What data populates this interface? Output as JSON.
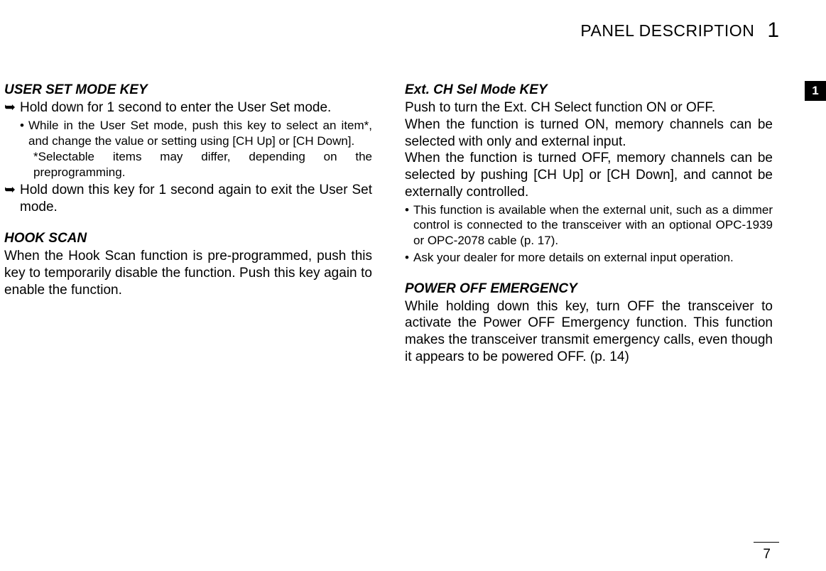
{
  "header": {
    "title": "PANEL DESCRIPTION",
    "chapter": "1"
  },
  "side_tab": "1",
  "left": {
    "user_set": {
      "title": "USER SET MODE KEY",
      "arrow1": "Hold down for 1 second to enter the User Set mode.",
      "bullet1": "While in the User Set mode, push this key to select an item*, and change the value or setting using [CH Up] or [CH Down].",
      "star": "*Selectable items may differ, depending on the preprogramming.",
      "arrow2": "Hold down this key for 1 second again to exit the User Set mode."
    },
    "hook_scan": {
      "title": "HOOK SCAN",
      "body": "When the Hook Scan function is pre-programmed, push this key to temporarily disable the function. Push this key again to enable the function."
    }
  },
  "right": {
    "ext_ch": {
      "title": "Ext. CH Sel Mode KEY",
      "p1": "Push to turn the Ext. CH Select function ON or OFF.",
      "p2": "When the function is turned ON, memory channels can be selected with only and external input.",
      "p3": "When the function is turned OFF, memory channels can be selected by pushing [CH Up] or [CH Down], and cannot be externally controlled.",
      "bullet1": "This function is available when the external unit, such as a dimmer control is connected to the transceiver with an optional OPC-1939 or OPC-2078 cable (p. 17).",
      "bullet2": "Ask your dealer for more details on external input operation."
    },
    "power_off": {
      "title": "POWER OFF EMERGENCY",
      "body": "While holding down this key, turn OFF the transceiver to activate the Power OFF Emergency function. This function makes the transceiver transmit emergency calls, even though it appears to be powered OFF. (p. 14)"
    }
  },
  "page_number": "7"
}
